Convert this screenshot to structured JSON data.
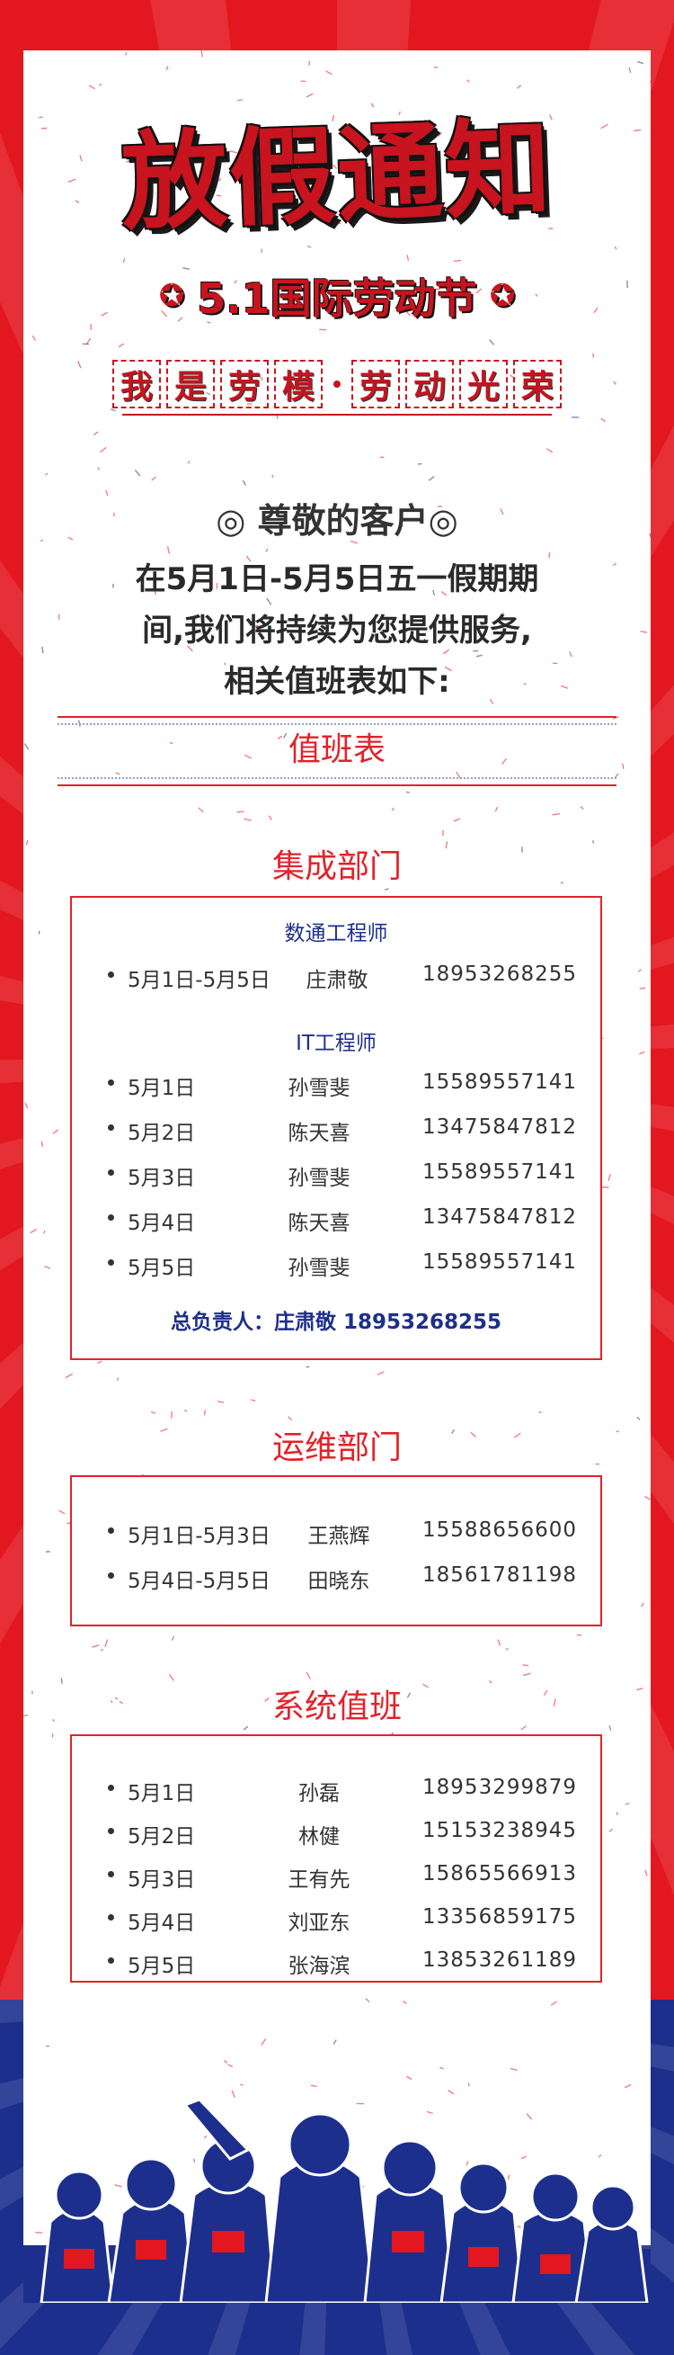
{
  "poster": {
    "title": "放假通知",
    "subtitle": "5.1国际劳动节",
    "slogan_left": [
      "我",
      "是",
      "劳",
      "模"
    ],
    "slogan_right": [
      "劳",
      "动",
      "光",
      "荣"
    ],
    "greeting": "◎ 尊敬的客户◎",
    "intro_lines": [
      "在5月1日-5月5日五一假期期",
      "间,我们将持续为您提供服务,",
      "相关值班表如下:"
    ],
    "table_title": "值班表",
    "colors": {
      "red": "#e3171f",
      "blue": "#1d2f8c",
      "paper": "#ffffff"
    }
  },
  "dept1": {
    "title": "集成部门",
    "group1_head": "数通工程师",
    "group1_rows": [
      {
        "date": "5月1日-5月5日",
        "name": "庄肃敬",
        "phone": "18953268255"
      }
    ],
    "group2_head": "IT工程师",
    "group2_rows": [
      {
        "date": "5月1日",
        "name": "孙雪斐",
        "phone": "15589557141"
      },
      {
        "date": "5月2日",
        "name": "陈天喜",
        "phone": "13475847812"
      },
      {
        "date": "5月3日",
        "name": "孙雪斐",
        "phone": "15589557141"
      },
      {
        "date": "5月4日",
        "name": "陈天喜",
        "phone": "13475847812"
      },
      {
        "date": "5月5日",
        "name": "孙雪斐",
        "phone": "15589557141"
      }
    ],
    "lead": "总负责人：庄肃敬 18953268255"
  },
  "dept2": {
    "title": "运维部门",
    "rows": [
      {
        "date": "5月1日-5月3日",
        "name": "王燕辉",
        "phone": "15588656600"
      },
      {
        "date": "5月4日-5月5日",
        "name": "田晓东",
        "phone": "18561781198"
      }
    ]
  },
  "dept3": {
    "title": "系统值班",
    "rows": [
      {
        "date": "5月1日",
        "name": "孙磊",
        "phone": "18953299879"
      },
      {
        "date": "5月2日",
        "name": "林健",
        "phone": "15153238945"
      },
      {
        "date": "5月3日",
        "name": "王有先",
        "phone": "15865566913"
      },
      {
        "date": "5月4日",
        "name": "刘亚东",
        "phone": "13356859175"
      },
      {
        "date": "5月5日",
        "name": "张海滨",
        "phone": "13853261189"
      }
    ]
  },
  "icons": {
    "star": "star-icon",
    "workers": "workers-illustration"
  }
}
